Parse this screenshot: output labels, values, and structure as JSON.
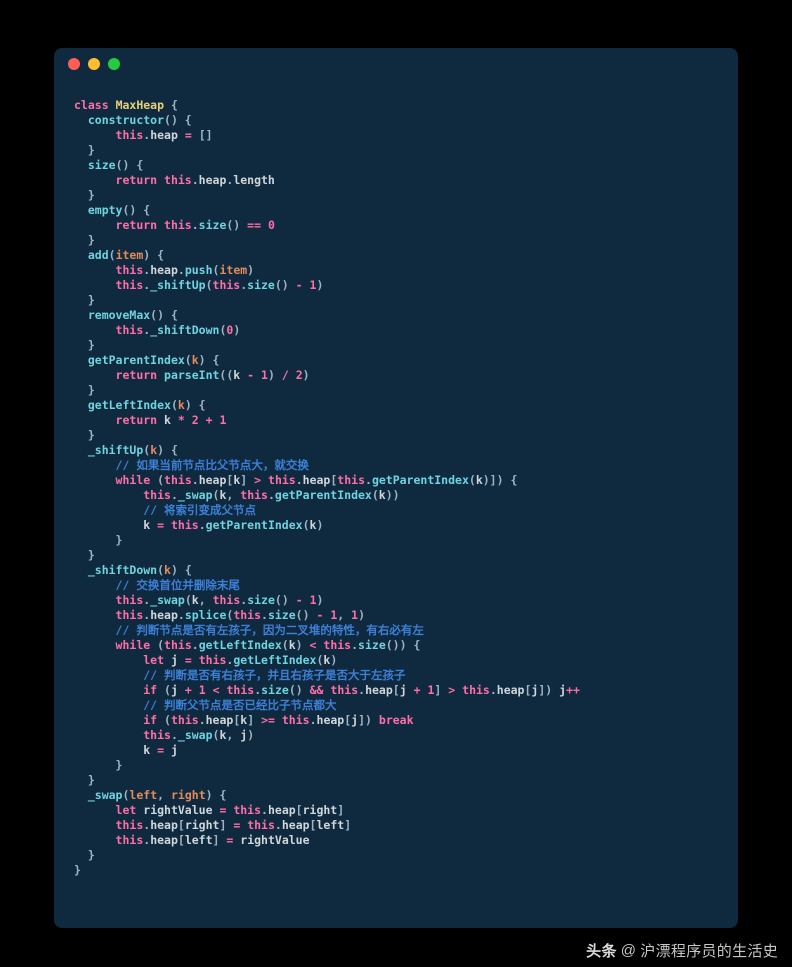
{
  "watermark": {
    "brand": "头条",
    "at": "@",
    "author": "沪漂程序员的生活史"
  },
  "code": {
    "l01a": "class",
    "l01b": "MaxHeap",
    "l02a": "constructor",
    "l03a": "this",
    "l03b": "heap",
    "l05a": "size",
    "l06a": "return",
    "l06b": "this",
    "l06c": "heap",
    "l06d": "length",
    "l08a": "empty",
    "l09a": "return",
    "l09b": "this",
    "l09c": "size",
    "l09d": "0",
    "l11a": "add",
    "l11b": "item",
    "l12a": "this",
    "l12b": "heap",
    "l12c": "push",
    "l12d": "item",
    "l13a": "this",
    "l13b": "_shiftUp",
    "l13c": "this",
    "l13d": "size",
    "l13e": "1",
    "l15a": "removeMax",
    "l16a": "this",
    "l16b": "_shiftDown",
    "l16c": "0",
    "l18a": "getParentIndex",
    "l18b": "k",
    "l19a": "return",
    "l19b": "parseInt",
    "l19c": "k",
    "l19d": "1",
    "l19e": "2",
    "l21a": "getLeftIndex",
    "l21b": "k",
    "l22a": "return",
    "l22b": "k",
    "l22c": "2",
    "l22d": "1",
    "l24a": "_shiftUp",
    "l24b": "k",
    "l25": "// 如果当前节点比父节点大，就交换",
    "l26a": "while",
    "l26b": "this",
    "l26c": "heap",
    "l26d": "k",
    "l26e": "this",
    "l26f": "heap",
    "l26g": "this",
    "l26h": "getParentIndex",
    "l26i": "k",
    "l27a": "this",
    "l27b": "_swap",
    "l27c": "k",
    "l27d": "this",
    "l27e": "getParentIndex",
    "l27f": "k",
    "l28": "// 将索引变成父节点",
    "l29a": "k",
    "l29b": "this",
    "l29c": "getParentIndex",
    "l29d": "k",
    "l32a": "_shiftDown",
    "l32b": "k",
    "l33": "// 交换首位并删除末尾",
    "l34a": "this",
    "l34b": "_swap",
    "l34c": "k",
    "l34d": "this",
    "l34e": "size",
    "l34f": "1",
    "l35a": "this",
    "l35b": "heap",
    "l35c": "splice",
    "l35d": "this",
    "l35e": "size",
    "l35f": "1",
    "l35g": "1",
    "l36": "// 判断节点是否有左孩子，因为二叉堆的特性，有右必有左",
    "l37a": "while",
    "l37b": "this",
    "l37c": "getLeftIndex",
    "l37d": "k",
    "l37e": "this",
    "l37f": "size",
    "l38a": "let",
    "l38b": "j",
    "l38c": "this",
    "l38d": "getLeftIndex",
    "l38e": "k",
    "l39": "// 判断是否有右孩子，并且右孩子是否大于左孩子",
    "l40a": "if",
    "l40b": "j",
    "l40c": "1",
    "l40d": "this",
    "l40e": "size",
    "l40f": "this",
    "l40g": "heap",
    "l40h": "j",
    "l40i": "1",
    "l40j": "this",
    "l40k": "heap",
    "l40l": "j",
    "l40m": "j",
    "l41": "// 判断父节点是否已经比子节点都大",
    "l42a": "if",
    "l42b": "this",
    "l42c": "heap",
    "l42d": "k",
    "l42e": "this",
    "l42f": "heap",
    "l42g": "j",
    "l42h": "break",
    "l43a": "this",
    "l43b": "_swap",
    "l43c": "k",
    "l43d": "j",
    "l44a": "k",
    "l44b": "j",
    "l47a": "_swap",
    "l47b": "left",
    "l47c": "right",
    "l48a": "let",
    "l48b": "rightValue",
    "l48c": "this",
    "l48d": "heap",
    "l48e": "right",
    "l49a": "this",
    "l49b": "heap",
    "l49c": "right",
    "l49d": "this",
    "l49e": "heap",
    "l49f": "left",
    "l50a": "this",
    "l50b": "heap",
    "l50c": "left",
    "l50d": "rightValue"
  }
}
